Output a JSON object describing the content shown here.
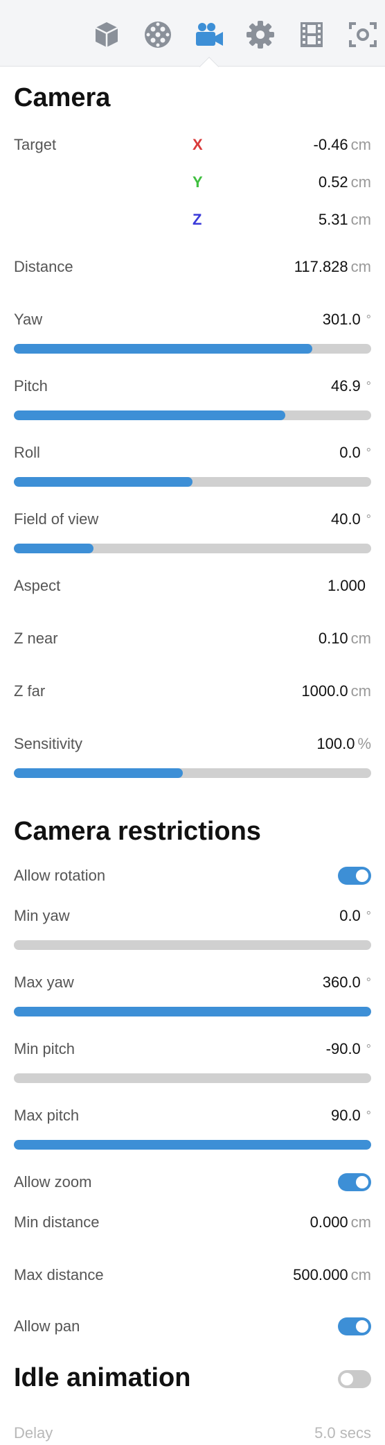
{
  "toolbar": {
    "icons": [
      "cube-icon",
      "material-ball-icon",
      "camera-icon",
      "gear-icon",
      "film-icon",
      "focus-icon"
    ],
    "active": "camera-icon",
    "accent": "#3d8fd6",
    "inactive_color": "#8a9099"
  },
  "camera": {
    "title": "Camera",
    "target_label": "Target",
    "x_letter": "X",
    "x_value": "-0.46",
    "x_unit": "cm",
    "x_color": "#d93a3a",
    "y_letter": "Y",
    "y_value": "0.52",
    "y_unit": "cm",
    "y_color": "#3fbf3f",
    "z_letter": "Z",
    "z_value": "5.31",
    "z_unit": "cm",
    "z_color": "#3a3ad9",
    "distance_label": "Distance",
    "distance_value": "117.828",
    "distance_unit": "cm",
    "yaw_label": "Yaw",
    "yaw_value": "301.0",
    "yaw_unit": "°",
    "yaw_fill": 0.836,
    "pitch_label": "Pitch",
    "pitch_value": "46.9",
    "pitch_unit": "°",
    "pitch_fill": 0.76,
    "roll_label": "Roll",
    "roll_value": "0.0",
    "roll_unit": "°",
    "roll_fill": 0.5,
    "fov_label": "Field of view",
    "fov_value": "40.0",
    "fov_unit": "°",
    "fov_fill": 0.223,
    "aspect_label": "Aspect",
    "aspect_value": "1.000",
    "znear_label": "Z near",
    "znear_value": "0.10",
    "znear_unit": "cm",
    "zfar_label": "Z far",
    "zfar_value": "1000.0",
    "zfar_unit": "cm",
    "sensitivity_label": "Sensitivity",
    "sensitivity_value": "100.0",
    "sensitivity_unit": "%",
    "sensitivity_fill": 0.473
  },
  "restrictions": {
    "title": "Camera restrictions",
    "allow_rotation_label": "Allow rotation",
    "allow_rotation": true,
    "min_yaw_label": "Min yaw",
    "min_yaw_value": "0.0",
    "min_yaw_unit": "°",
    "min_yaw_fill": 0.0,
    "max_yaw_label": "Max yaw",
    "max_yaw_value": "360.0",
    "max_yaw_unit": "°",
    "max_yaw_fill": 1.0,
    "min_pitch_label": "Min pitch",
    "min_pitch_value": "-90.0",
    "min_pitch_unit": "°",
    "min_pitch_fill": 0.0,
    "max_pitch_label": "Max pitch",
    "max_pitch_value": "90.0",
    "max_pitch_unit": "°",
    "max_pitch_fill": 1.0,
    "allow_zoom_label": "Allow zoom",
    "allow_zoom": true,
    "min_distance_label": "Min distance",
    "min_distance_value": "0.000",
    "min_distance_unit": "cm",
    "max_distance_label": "Max distance",
    "max_distance_value": "500.000",
    "max_distance_unit": "cm",
    "allow_pan_label": "Allow pan",
    "allow_pan": true
  },
  "idle": {
    "title": "Idle animation",
    "enabled": false,
    "delay_label": "Delay",
    "delay_value": "5.0 secs"
  }
}
